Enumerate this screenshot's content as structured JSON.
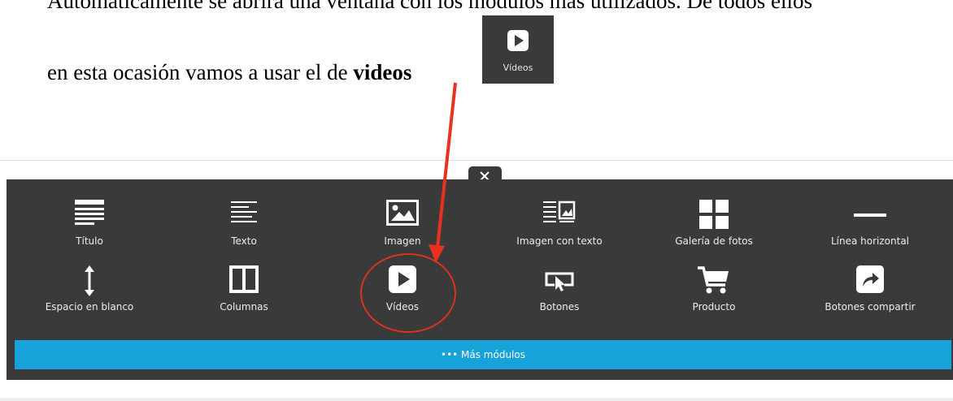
{
  "document": {
    "line1": "Automaticamente se abrirá una ventana con los módulos más utilizados. De todos ellos",
    "line2_prefix": "en esta ocasión vamos a usar el de ",
    "line2_bold": "videos"
  },
  "highlight_tile": {
    "label": "Vídeos",
    "icon": "play-icon"
  },
  "panel": {
    "close_icon": "close-icon",
    "modules": [
      {
        "label": "Título",
        "icon": "title-icon"
      },
      {
        "label": "Texto",
        "icon": "text-icon"
      },
      {
        "label": "Imagen",
        "icon": "image-icon"
      },
      {
        "label": "Imagen con texto",
        "icon": "image-with-text-icon"
      },
      {
        "label": "Galería de fotos",
        "icon": "gallery-icon"
      },
      {
        "label": "Línea horizontal",
        "icon": "horizontal-line-icon"
      },
      {
        "label": "Espacio en blanco",
        "icon": "vertical-space-icon"
      },
      {
        "label": "Columnas",
        "icon": "columns-icon"
      },
      {
        "label": "Vídeos",
        "icon": "play-icon"
      },
      {
        "label": "Botones",
        "icon": "button-cursor-icon"
      },
      {
        "label": "Producto",
        "icon": "cart-icon"
      },
      {
        "label": "Botones compartir",
        "icon": "share-icon"
      }
    ],
    "more_button": {
      "label": "••• Más módulos"
    }
  },
  "colors": {
    "panel_bg": "#3a3a3a",
    "accent_blue": "#17a2d9",
    "annotation_red": "#e8321e"
  }
}
